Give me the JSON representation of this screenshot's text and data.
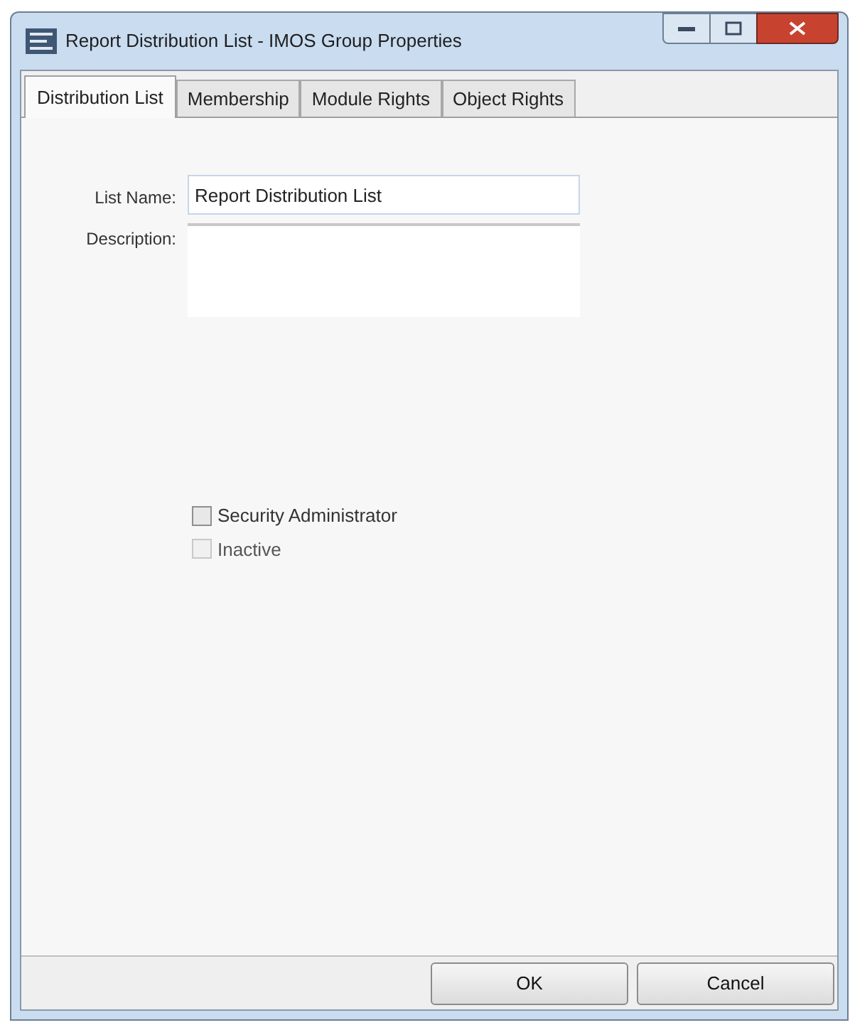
{
  "window": {
    "title": "Report Distribution List - IMOS Group Properties"
  },
  "tabs": [
    {
      "label": "Distribution List",
      "selected": true
    },
    {
      "label": "Membership",
      "selected": false
    },
    {
      "label": "Module Rights",
      "selected": false
    },
    {
      "label": "Object Rights",
      "selected": false
    }
  ],
  "fields": [
    {
      "label": "List Name:",
      "value": "Report Distribution List",
      "kind": "text"
    },
    {
      "label": "Description:",
      "kind": "multiline"
    }
  ],
  "checkboxes": [
    {
      "label": "Security Administrator",
      "checked": false,
      "disabled": false
    },
    {
      "label": "Inactive",
      "checked": false,
      "disabled": true
    }
  ],
  "buttons": [
    "OK",
    "Cancel"
  ]
}
